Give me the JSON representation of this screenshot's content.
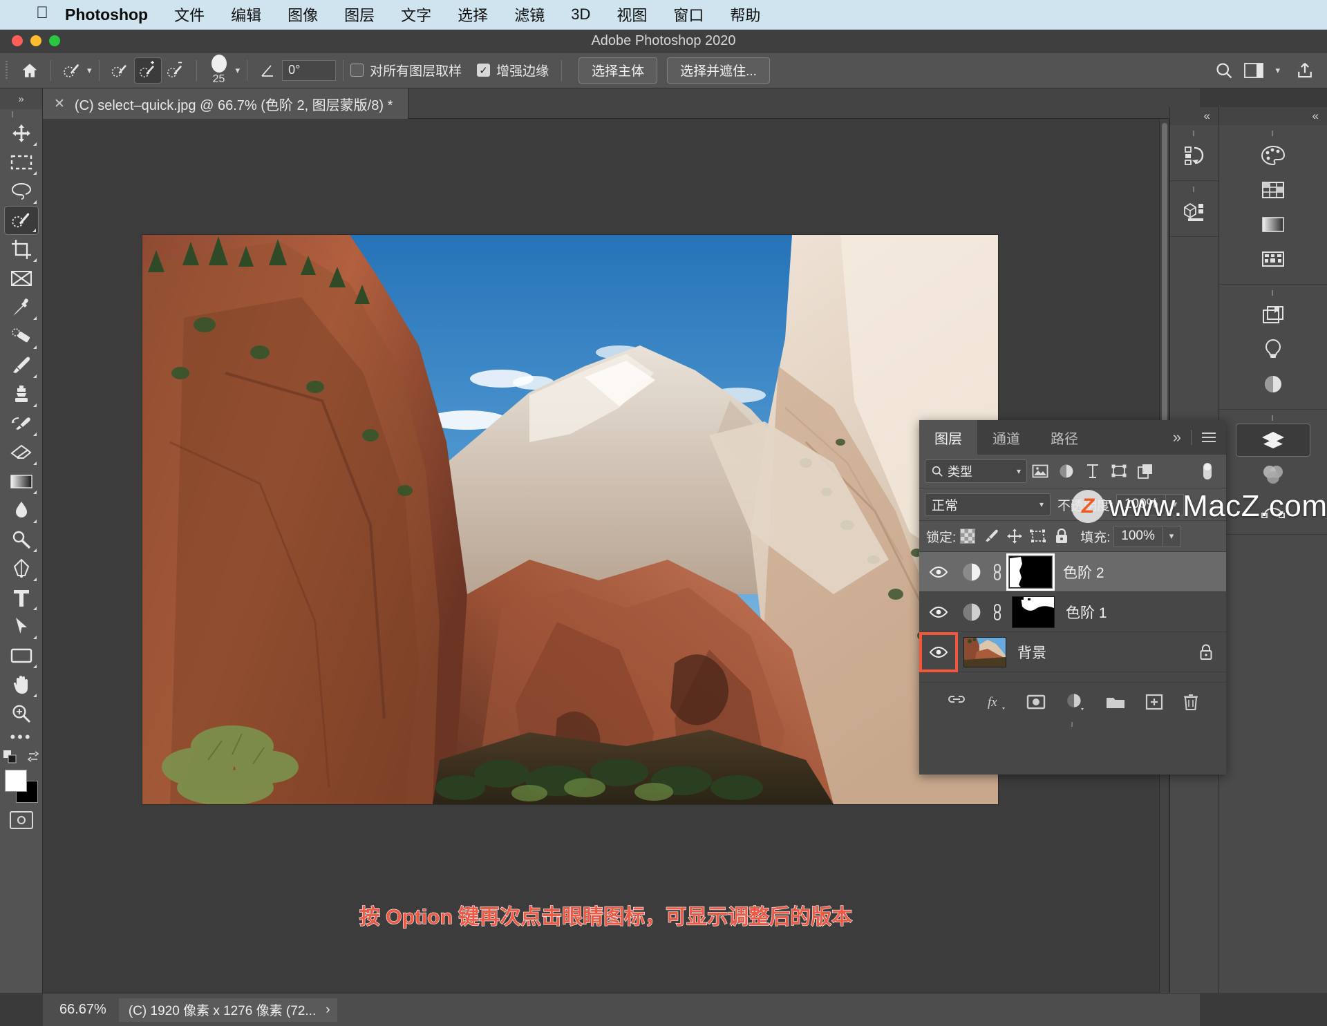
{
  "mac_menu": {
    "apple_icon": "apple-logo",
    "app_name": "Photoshop",
    "items": [
      "文件",
      "编辑",
      "图像",
      "图层",
      "文字",
      "选择",
      "滤镜",
      "3D",
      "视图",
      "窗口",
      "帮助"
    ]
  },
  "window": {
    "title": "Adobe Photoshop 2020"
  },
  "options_bar": {
    "home_icon": "home-icon",
    "tool_preset_icon": "quick-selection-icon",
    "mode_new_icon": "selection-new-icon",
    "mode_add_icon": "selection-add-icon",
    "mode_subtract_icon": "selection-subtract-icon",
    "brush_size": "25",
    "angle_icon": "angle-icon",
    "angle_value": "0°",
    "sample_all_layers": {
      "label": "对所有图层取样",
      "checked": false
    },
    "enhance_edge": {
      "label": "增强边缘",
      "checked": true
    },
    "select_subject": "选择主体",
    "select_and_mask": "选择并遮住...",
    "search_icon": "search-icon",
    "workspace_icon": "workspace-icon",
    "chevron_icon": "chevron-down-icon",
    "share_icon": "share-icon"
  },
  "toolbar": {
    "collapse": "»",
    "tools": [
      {
        "name": "move-tool",
        "icon": "move-icon",
        "active": false
      },
      {
        "name": "marquee-tool",
        "icon": "rect-marquee-icon",
        "active": false
      },
      {
        "name": "lasso-tool",
        "icon": "lasso-icon",
        "active": false
      },
      {
        "name": "quick-selection-tool",
        "icon": "quick-selection-icon",
        "active": true
      },
      {
        "name": "crop-tool",
        "icon": "crop-icon",
        "active": false
      },
      {
        "name": "frame-tool",
        "icon": "frame-icon",
        "active": false
      },
      {
        "name": "eyedropper-tool",
        "icon": "eyedropper-icon",
        "active": false
      },
      {
        "name": "healing-brush-tool",
        "icon": "spot-healing-icon",
        "active": false
      },
      {
        "name": "brush-tool",
        "icon": "brush-icon",
        "active": false
      },
      {
        "name": "clone-stamp-tool",
        "icon": "clone-stamp-icon",
        "active": false
      },
      {
        "name": "history-brush-tool",
        "icon": "history-brush-icon",
        "active": false
      },
      {
        "name": "eraser-tool",
        "icon": "eraser-icon",
        "active": false
      },
      {
        "name": "gradient-tool",
        "icon": "gradient-icon",
        "active": false
      },
      {
        "name": "blur-tool",
        "icon": "blur-drop-icon",
        "active": false
      },
      {
        "name": "dodge-tool",
        "icon": "dodge-icon",
        "active": false
      },
      {
        "name": "pen-tool",
        "icon": "pen-icon",
        "active": false
      },
      {
        "name": "type-tool",
        "icon": "type-icon",
        "active": false
      },
      {
        "name": "path-selection-tool",
        "icon": "path-arrow-icon",
        "active": false
      },
      {
        "name": "rectangle-tool",
        "icon": "rectangle-icon",
        "active": false
      },
      {
        "name": "hand-tool",
        "icon": "hand-icon",
        "active": false
      },
      {
        "name": "zoom-tool",
        "icon": "zoom-icon",
        "active": false
      }
    ],
    "more": "•••",
    "foreground_color": "#ffffff",
    "background_color": "#000000",
    "quick_mask_icon": "quick-mask-icon"
  },
  "document_tab": {
    "close_icon": "close-icon",
    "title": "(C) select–quick.jpg @ 66.7% (色阶 2, 图层蒙版/8) *"
  },
  "canvas": {
    "caption": "按 Option 键再次点击眼睛图标，可显示调整后的版本",
    "caption_color": "#ec5a46"
  },
  "layers_panel": {
    "tabs": [
      {
        "label": "图层",
        "active": true
      },
      {
        "label": "通道",
        "active": false
      },
      {
        "label": "路径",
        "active": false
      }
    ],
    "expand_icon": "chevrons-right-icon",
    "menu_icon": "panel-menu-icon",
    "filter": {
      "search_icon": "search-icon",
      "type_label": "类型",
      "chevron_icon": "chevron-down-icon",
      "icons": [
        "pixel-filter-icon",
        "adjustment-filter-icon",
        "type-filter-icon",
        "shape-filter-icon",
        "smart-object-filter-icon"
      ],
      "toggle_icon": "filter-toggle-icon"
    },
    "blend_mode": "正常",
    "opacity_label": "不透明度:",
    "opacity_value": "100%",
    "lock_label": "锁定:",
    "lock_icons": [
      "lock-transparency-icon",
      "lock-image-icon",
      "lock-position-icon",
      "lock-artboard-icon",
      "lock-all-icon"
    ],
    "fill_label": "填充:",
    "fill_value": "100%",
    "layers": [
      {
        "name": "色阶 2",
        "visible": true,
        "selected": true,
        "type": "adjustment",
        "adjustment_icon": "levels-adjustment-icon",
        "link_icon": "link-mask-icon",
        "mask_selected": true,
        "locked": false,
        "eye_highlight": false
      },
      {
        "name": "色阶 1",
        "visible": true,
        "selected": false,
        "type": "adjustment",
        "adjustment_icon": "levels-adjustment-icon",
        "link_icon": "link-mask-icon",
        "mask_selected": false,
        "locked": false,
        "eye_highlight": false
      },
      {
        "name": "背景",
        "visible": true,
        "selected": false,
        "type": "image",
        "locked": true,
        "lock_icon": "lock-icon",
        "eye_highlight": true
      }
    ],
    "highlight_color": "#f4553d",
    "bottom_buttons": [
      {
        "name": "link-layers-button",
        "icon": "link-icon"
      },
      {
        "name": "layer-style-button",
        "icon": "fx-icon"
      },
      {
        "name": "add-mask-button",
        "icon": "mask-icon"
      },
      {
        "name": "new-adjustment-layer-button",
        "icon": "adjustment-icon"
      },
      {
        "name": "new-group-button",
        "icon": "folder-icon"
      },
      {
        "name": "new-layer-button",
        "icon": "plus-square-icon"
      },
      {
        "name": "delete-layer-button",
        "icon": "trash-icon"
      }
    ]
  },
  "right_dock": {
    "collapse_icon": "chevrons-left-icon",
    "column_a": [
      {
        "name": "history-panel-icon",
        "icon": "history-icon"
      },
      {
        "name": "3d-panel-icon",
        "icon": "cube-icon"
      }
    ],
    "column_b": [
      {
        "name": "color-panel-icon",
        "icon": "palette-icon"
      },
      {
        "name": "swatches-panel-icon",
        "icon": "grid-icon"
      },
      {
        "name": "gradients-panel-icon",
        "icon": "gradient-icon"
      },
      {
        "name": "patterns-panel-icon",
        "icon": "pattern-icon"
      },
      {
        "name": "libraries-panel-icon",
        "icon": "library-icon"
      },
      {
        "name": "adjustments-panel-icon",
        "icon": "bulb-icon"
      },
      {
        "name": "properties-panel-icon",
        "icon": "half-circle-icon"
      },
      {
        "name": "layers-panel-icon",
        "icon": "layers-icon",
        "active": true
      },
      {
        "name": "channels-panel-icon",
        "icon": "channels-icon"
      },
      {
        "name": "paths-panel-icon",
        "icon": "paths-icon"
      }
    ]
  },
  "watermark": {
    "badge": "Z",
    "text": "www.MacZ.com"
  },
  "status_bar": {
    "zoom": "66.67%",
    "doc_info": "(C) 1920 像素 x 1276 像素 (72...",
    "chevron_icon": "chevron-right-icon"
  }
}
